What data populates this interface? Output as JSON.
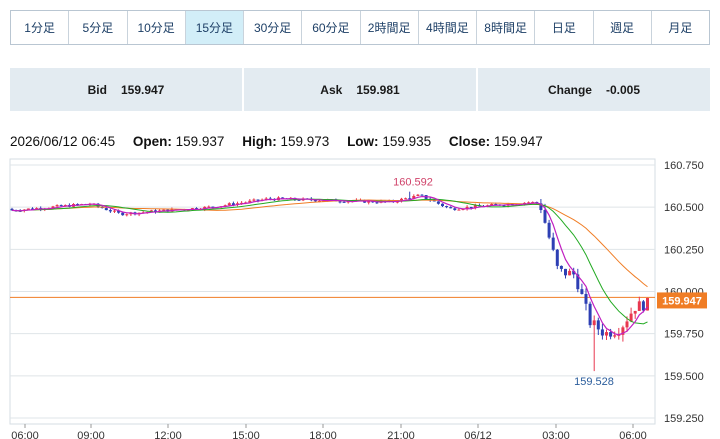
{
  "timeframe_tabs": [
    {
      "label": "1分足",
      "active": false
    },
    {
      "label": "5分足",
      "active": false
    },
    {
      "label": "10分足",
      "active": false
    },
    {
      "label": "15分足",
      "active": true
    },
    {
      "label": "30分足",
      "active": false
    },
    {
      "label": "60分足",
      "active": false
    },
    {
      "label": "2時間足",
      "active": false
    },
    {
      "label": "4時間足",
      "active": false
    },
    {
      "label": "8時間足",
      "active": false
    },
    {
      "label": "日足",
      "active": false
    },
    {
      "label": "週足",
      "active": false
    },
    {
      "label": "月足",
      "active": false
    }
  ],
  "quote": {
    "bid_label": "Bid",
    "bid_value": "159.947",
    "ask_label": "Ask",
    "ask_value": "159.981",
    "change_label": "Change",
    "change_value": "-0.005"
  },
  "ohlc": {
    "datetime": "2026/06/12 06:45",
    "open_label": "Open:",
    "open": "159.937",
    "high_label": "High:",
    "high": "159.973",
    "low_label": "Low:",
    "low": "159.935",
    "close_label": "Close:",
    "close": "159.947"
  },
  "colors": {
    "accent": "#f07d25",
    "up": "#e8374f",
    "down": "#2d3fb4",
    "ma_short": "#c11fc1",
    "ma_mid": "#22aa22",
    "ma_long": "#f07d25",
    "tab_active_bg": "#d2eef8",
    "quote_bg": "#e3ebf1"
  },
  "chart_data": {
    "type": "candlestick",
    "y_ticks": [
      "160.750",
      "160.500",
      "160.250",
      "160.000",
      "159.750",
      "159.500",
      "159.250"
    ],
    "ylim": [
      159.25,
      160.75
    ],
    "x_ticks": [
      "06:00",
      "09:00",
      "12:00",
      "15:00",
      "18:00",
      "21:00",
      "06/12",
      "03:00",
      "06:00"
    ],
    "current_price_label": "159.947",
    "current_price": 159.947,
    "high_annotation": "160.592",
    "low_annotation": "159.528",
    "reference_line": 159.965,
    "moving_averages": [
      "short",
      "mid",
      "long"
    ],
    "grid": true
  }
}
